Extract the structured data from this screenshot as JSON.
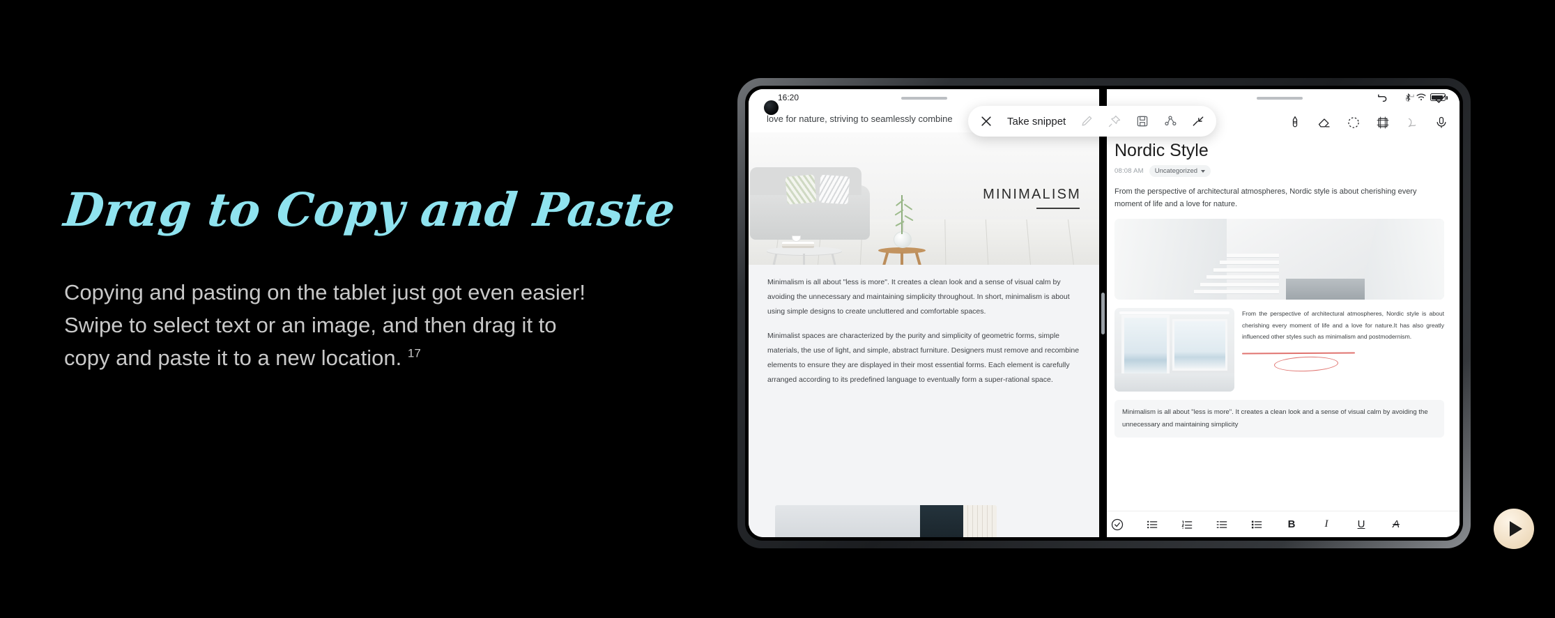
{
  "hero": {
    "headline": "Drag to Copy and Paste",
    "body": "Copying and pasting on the tablet just got even easier! Swipe to select text or an image, and then drag it to copy and paste it to a new location.",
    "footnote": "17",
    "headline_color": "#8fe3ef",
    "body_color": "#c9c9c9",
    "background": "#000000"
  },
  "play_button": {
    "label": "play-overlay"
  },
  "device": {
    "left_pane": {
      "status": {
        "time": "16:20"
      },
      "article": {
        "top_line": "love for nature, striving to seamlessly combine",
        "hero_image_title": "MINIMALISM",
        "paragraphs": [
          "Minimalism is all about \"less is more\". It creates a clean look and a sense of visual calm by avoiding the unnecessary and maintaining simplicity throughout. In short, minimalism is about using simple designs to create uncluttered and comfortable spaces.",
          "Minimalist spaces are characterized by the purity and simplicity of geometric forms, simple materials, the use of light, and simple, abstract furniture. Designers must remove and recombine elements to ensure they are displayed in their most essential forms. Each element is carefully arranged according to its predefined language to eventually form a super-rational space."
        ]
      }
    },
    "right_pane": {
      "status": {
        "icons": [
          "bluetooth-icon",
          "wifi-icon",
          "battery-icon"
        ]
      },
      "toolbar": {
        "colors": [
          "#1a73e8",
          "#f2b418",
          "#34a853"
        ],
        "tools": [
          "pen-icon",
          "eraser-icon",
          "lasso-select-icon",
          "frame-icon",
          "shape-icon",
          "microphone-icon"
        ],
        "actions": [
          "undo-icon",
          "redo-icon",
          "confirm-check-icon"
        ]
      },
      "note": {
        "title": "Nordic Style",
        "time": "08:08 AM",
        "category": "Uncategorized",
        "lead": "From the perspective of architectural atmospheres, Nordic style is about cherishing every moment of life and a love for nature.",
        "annotated_text": "From the perspective of architectural atmospheres, Nordic style is about cherishing every moment of life and a love for nature.It has also greatly influenced other styles such as minimalism and postmodernism.",
        "pasted_snippet": "Minimalism is all about \"less is more\". It creates a clean look and a sense of visual calm by avoiding the unnecessary and maintaining simplicity",
        "ink_color": "#e0736f"
      },
      "format_bar": {
        "items": [
          "checklist-icon",
          "bullet-list-icon",
          "numbered-list-icon",
          "dash-list-icon",
          "todo-list-icon"
        ],
        "bold": "B",
        "italic": "I",
        "underline": "U",
        "strikethrough": "A"
      }
    },
    "snippet_toolbar": {
      "close": "close-icon",
      "label": "Take snippet",
      "tools": [
        "pen-icon",
        "pin-icon",
        "save-icon",
        "share-node-icon",
        "collapse-icon"
      ]
    }
  }
}
